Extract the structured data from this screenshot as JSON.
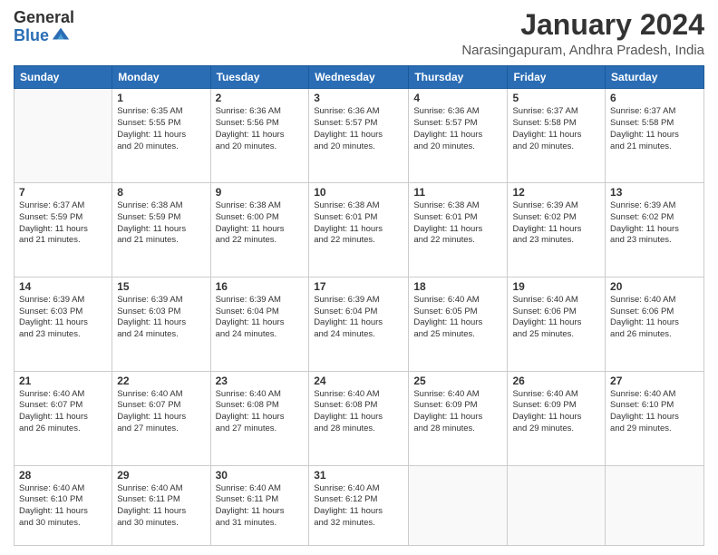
{
  "header": {
    "logo_general": "General",
    "logo_blue": "Blue",
    "month_year": "January 2024",
    "location": "Narasingapuram, Andhra Pradesh, India"
  },
  "weekdays": [
    "Sunday",
    "Monday",
    "Tuesday",
    "Wednesday",
    "Thursday",
    "Friday",
    "Saturday"
  ],
  "weeks": [
    [
      {
        "day": "",
        "info": ""
      },
      {
        "day": "1",
        "info": "Sunrise: 6:35 AM\nSunset: 5:55 PM\nDaylight: 11 hours\nand 20 minutes."
      },
      {
        "day": "2",
        "info": "Sunrise: 6:36 AM\nSunset: 5:56 PM\nDaylight: 11 hours\nand 20 minutes."
      },
      {
        "day": "3",
        "info": "Sunrise: 6:36 AM\nSunset: 5:57 PM\nDaylight: 11 hours\nand 20 minutes."
      },
      {
        "day": "4",
        "info": "Sunrise: 6:36 AM\nSunset: 5:57 PM\nDaylight: 11 hours\nand 20 minutes."
      },
      {
        "day": "5",
        "info": "Sunrise: 6:37 AM\nSunset: 5:58 PM\nDaylight: 11 hours\nand 20 minutes."
      },
      {
        "day": "6",
        "info": "Sunrise: 6:37 AM\nSunset: 5:58 PM\nDaylight: 11 hours\nand 21 minutes."
      }
    ],
    [
      {
        "day": "7",
        "info": "Sunrise: 6:37 AM\nSunset: 5:59 PM\nDaylight: 11 hours\nand 21 minutes."
      },
      {
        "day": "8",
        "info": "Sunrise: 6:38 AM\nSunset: 5:59 PM\nDaylight: 11 hours\nand 21 minutes."
      },
      {
        "day": "9",
        "info": "Sunrise: 6:38 AM\nSunset: 6:00 PM\nDaylight: 11 hours\nand 22 minutes."
      },
      {
        "day": "10",
        "info": "Sunrise: 6:38 AM\nSunset: 6:01 PM\nDaylight: 11 hours\nand 22 minutes."
      },
      {
        "day": "11",
        "info": "Sunrise: 6:38 AM\nSunset: 6:01 PM\nDaylight: 11 hours\nand 22 minutes."
      },
      {
        "day": "12",
        "info": "Sunrise: 6:39 AM\nSunset: 6:02 PM\nDaylight: 11 hours\nand 23 minutes."
      },
      {
        "day": "13",
        "info": "Sunrise: 6:39 AM\nSunset: 6:02 PM\nDaylight: 11 hours\nand 23 minutes."
      }
    ],
    [
      {
        "day": "14",
        "info": "Sunrise: 6:39 AM\nSunset: 6:03 PM\nDaylight: 11 hours\nand 23 minutes."
      },
      {
        "day": "15",
        "info": "Sunrise: 6:39 AM\nSunset: 6:03 PM\nDaylight: 11 hours\nand 24 minutes."
      },
      {
        "day": "16",
        "info": "Sunrise: 6:39 AM\nSunset: 6:04 PM\nDaylight: 11 hours\nand 24 minutes."
      },
      {
        "day": "17",
        "info": "Sunrise: 6:39 AM\nSunset: 6:04 PM\nDaylight: 11 hours\nand 24 minutes."
      },
      {
        "day": "18",
        "info": "Sunrise: 6:40 AM\nSunset: 6:05 PM\nDaylight: 11 hours\nand 25 minutes."
      },
      {
        "day": "19",
        "info": "Sunrise: 6:40 AM\nSunset: 6:06 PM\nDaylight: 11 hours\nand 25 minutes."
      },
      {
        "day": "20",
        "info": "Sunrise: 6:40 AM\nSunset: 6:06 PM\nDaylight: 11 hours\nand 26 minutes."
      }
    ],
    [
      {
        "day": "21",
        "info": "Sunrise: 6:40 AM\nSunset: 6:07 PM\nDaylight: 11 hours\nand 26 minutes."
      },
      {
        "day": "22",
        "info": "Sunrise: 6:40 AM\nSunset: 6:07 PM\nDaylight: 11 hours\nand 27 minutes."
      },
      {
        "day": "23",
        "info": "Sunrise: 6:40 AM\nSunset: 6:08 PM\nDaylight: 11 hours\nand 27 minutes."
      },
      {
        "day": "24",
        "info": "Sunrise: 6:40 AM\nSunset: 6:08 PM\nDaylight: 11 hours\nand 28 minutes."
      },
      {
        "day": "25",
        "info": "Sunrise: 6:40 AM\nSunset: 6:09 PM\nDaylight: 11 hours\nand 28 minutes."
      },
      {
        "day": "26",
        "info": "Sunrise: 6:40 AM\nSunset: 6:09 PM\nDaylight: 11 hours\nand 29 minutes."
      },
      {
        "day": "27",
        "info": "Sunrise: 6:40 AM\nSunset: 6:10 PM\nDaylight: 11 hours\nand 29 minutes."
      }
    ],
    [
      {
        "day": "28",
        "info": "Sunrise: 6:40 AM\nSunset: 6:10 PM\nDaylight: 11 hours\nand 30 minutes."
      },
      {
        "day": "29",
        "info": "Sunrise: 6:40 AM\nSunset: 6:11 PM\nDaylight: 11 hours\nand 30 minutes."
      },
      {
        "day": "30",
        "info": "Sunrise: 6:40 AM\nSunset: 6:11 PM\nDaylight: 11 hours\nand 31 minutes."
      },
      {
        "day": "31",
        "info": "Sunrise: 6:40 AM\nSunset: 6:12 PM\nDaylight: 11 hours\nand 32 minutes."
      },
      {
        "day": "",
        "info": ""
      },
      {
        "day": "",
        "info": ""
      },
      {
        "day": "",
        "info": ""
      }
    ]
  ]
}
